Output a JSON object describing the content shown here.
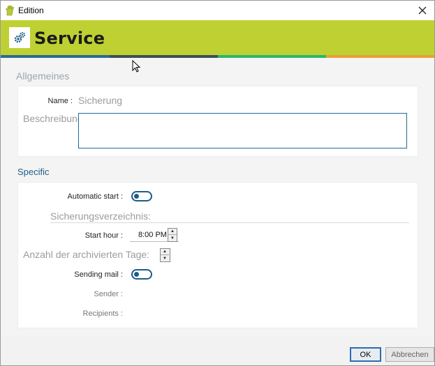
{
  "window": {
    "title": "Edition",
    "close_glyph": "✕"
  },
  "banner": {
    "title": "Service",
    "icon": "gears-icon",
    "color": "#bfd132"
  },
  "accent_stripes": [
    "#2c6a93",
    "#3d4d5c",
    "#27b86a",
    "#e6a13a"
  ],
  "general": {
    "section_title": "Allgemeines",
    "name_label": "Name :",
    "name_value": "Sicherung",
    "description_label": "Beschreibung:",
    "description_value": ""
  },
  "specific": {
    "section_title": "Specific",
    "automatic_start_label": "Automatic start :",
    "automatic_start_on": false,
    "backup_directory_label": "Sicherungsverzeichnis:",
    "start_hour_label": "Start hour :",
    "start_hour_value": "8:00 PM",
    "archived_days_label": "Anzahl der archivierten Tage:",
    "sending_mail_label": "Sending mail :",
    "sending_mail_on": false,
    "sender_label": "Sender :",
    "recipients_label": "Recipients :"
  },
  "footer": {
    "ok_label": "OK",
    "cancel_label": "Abbrechen"
  }
}
